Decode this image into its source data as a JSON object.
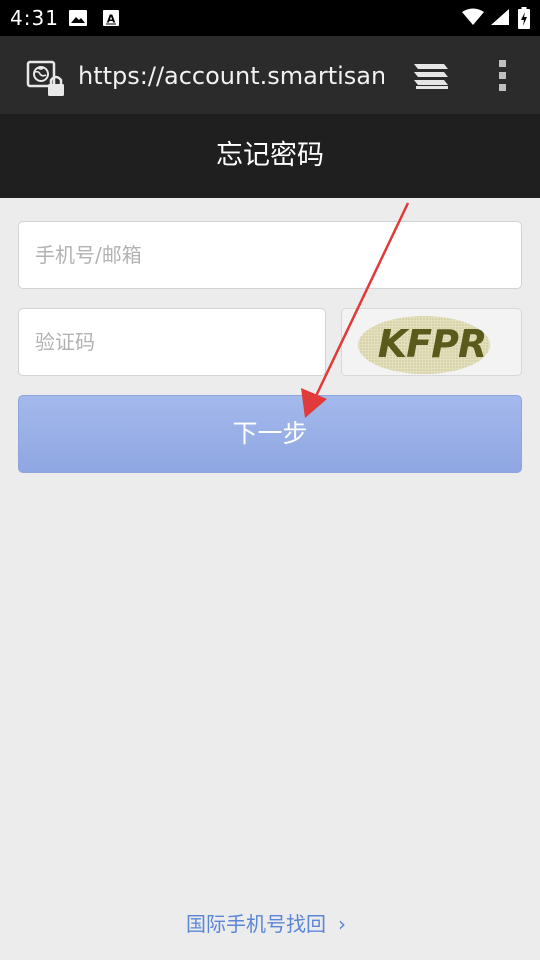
{
  "status_bar": {
    "time": "4:31",
    "icons": [
      "image-notification-icon",
      "font-notification-icon",
      "wifi-icon",
      "cellular-signal-icon",
      "battery-charging-icon"
    ]
  },
  "browser": {
    "url": "https://account.smartisan.com",
    "icons": [
      "secure-site-icon",
      "tabs-icon",
      "overflow-menu-icon"
    ]
  },
  "page": {
    "title": "忘记密码",
    "phone_placeholder": "手机号/邮箱",
    "code_placeholder": "验证码",
    "captcha_text": "KFPR",
    "next_label": "下一步",
    "intl_link": "国际手机号找回",
    "intl_chevron": "›"
  },
  "colors": {
    "status_bar": "#000000",
    "address_bar": "#2b2b2b",
    "title_bar": "#1f1f1f",
    "page_bg": "#ececec",
    "button": "#98aee6",
    "link": "#5b86d6",
    "annotation_arrow": "#e03a3a",
    "captcha_letters": "#5a5a1c"
  }
}
